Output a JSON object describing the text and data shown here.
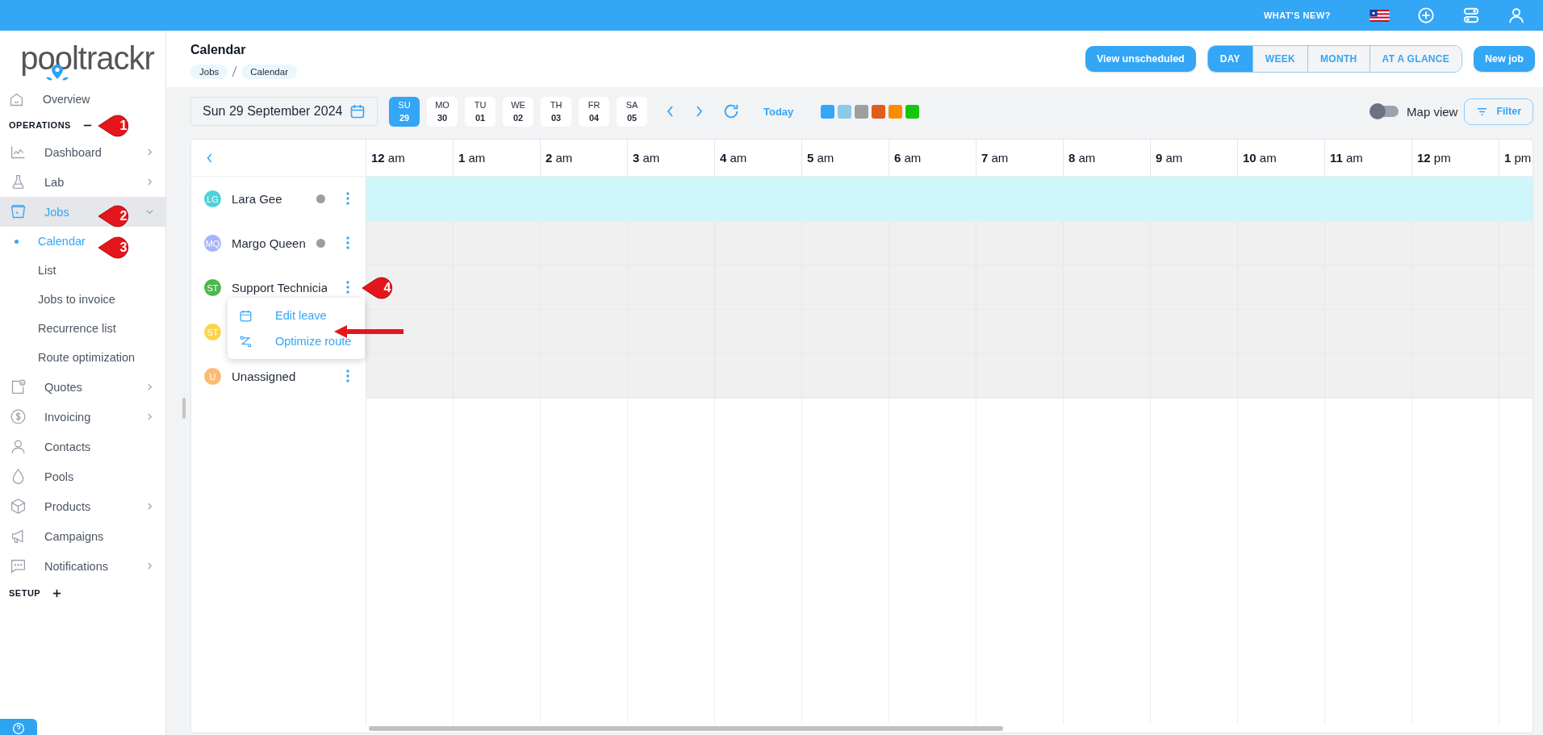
{
  "topbar": {
    "whats_new": "WHAT'S NEW?"
  },
  "logo": {
    "text": "pooltrackr"
  },
  "sidebar": {
    "top_item": {
      "label": "Overview",
      "selected": false
    },
    "sections": [
      {
        "title": "OPERATIONS",
        "expanded": true,
        "items": [
          {
            "label": "Dashboard",
            "selected": false,
            "has_children": true,
            "expanded": false
          },
          {
            "label": "Lab",
            "selected": false,
            "has_children": true,
            "expanded": false
          },
          {
            "label": "Jobs",
            "selected": true,
            "has_children": true,
            "expanded": true,
            "children": [
              {
                "label": "Calendar",
                "selected": true
              },
              {
                "label": "List",
                "selected": false
              },
              {
                "label": "Jobs to invoice",
                "selected": false
              },
              {
                "label": "Recurrence list",
                "selected": false
              },
              {
                "label": "Route optimization",
                "selected": false
              }
            ]
          },
          {
            "label": "Quotes",
            "selected": false,
            "has_children": true,
            "expanded": false
          },
          {
            "label": "Invoicing",
            "selected": false,
            "has_children": true,
            "expanded": false
          },
          {
            "label": "Contacts",
            "selected": false,
            "has_children": false
          },
          {
            "label": "Pools",
            "selected": false,
            "has_children": false
          },
          {
            "label": "Products",
            "selected": false,
            "has_children": true,
            "expanded": false
          },
          {
            "label": "Campaigns",
            "selected": false,
            "has_children": false
          },
          {
            "label": "Notifications",
            "selected": false,
            "has_children": true,
            "expanded": false
          }
        ]
      },
      {
        "title": "SETUP",
        "expanded": false
      }
    ]
  },
  "header": {
    "title": "Calendar",
    "breadcrumbs": [
      "Jobs",
      "Calendar"
    ],
    "view_unscheduled": "View unscheduled",
    "view_tabs": [
      {
        "label": "DAY",
        "selected": true
      },
      {
        "label": "WEEK",
        "selected": false
      },
      {
        "label": "MONTH",
        "selected": false
      },
      {
        "label": "AT A GLANCE",
        "selected": false
      }
    ],
    "new_job": "New job"
  },
  "toolbar": {
    "date": "Sun 29 September 2024",
    "days": [
      {
        "dow": "SU",
        "date": "29",
        "selected": true
      },
      {
        "dow": "MO",
        "date": "30",
        "selected": false
      },
      {
        "dow": "TU",
        "date": "01",
        "selected": false
      },
      {
        "dow": "WE",
        "date": "02",
        "selected": false
      },
      {
        "dow": "TH",
        "date": "03",
        "selected": false
      },
      {
        "dow": "FR",
        "date": "04",
        "selected": false
      },
      {
        "dow": "SA",
        "date": "05",
        "selected": false
      }
    ],
    "today": "Today",
    "color_filters": [
      {
        "color": "#33a6f5"
      },
      {
        "color": "#8ecae6"
      },
      {
        "color": "#9e9e9e"
      },
      {
        "color": "#e05d1b"
      },
      {
        "color": "#fb8c00"
      },
      {
        "color": "#16c60c"
      }
    ],
    "map_view": {
      "label": "Map view",
      "on": false
    },
    "filter": "Filter"
  },
  "grid": {
    "hours": [
      {
        "hour": "12",
        "ampm": "am"
      },
      {
        "hour": "1",
        "ampm": "am"
      },
      {
        "hour": "2",
        "ampm": "am"
      },
      {
        "hour": "3",
        "ampm": "am"
      },
      {
        "hour": "4",
        "ampm": "am"
      },
      {
        "hour": "5",
        "ampm": "am"
      },
      {
        "hour": "6",
        "ampm": "am"
      },
      {
        "hour": "7",
        "ampm": "am"
      },
      {
        "hour": "8",
        "ampm": "am"
      },
      {
        "hour": "9",
        "ampm": "am"
      },
      {
        "hour": "10",
        "ampm": "am"
      },
      {
        "hour": "11",
        "ampm": "am"
      },
      {
        "hour": "12",
        "ampm": "pm"
      },
      {
        "hour": "1",
        "ampm": "pm"
      }
    ],
    "resources": [
      {
        "initials": "LG",
        "name": "Lara Gee",
        "color": "#4fd1d9",
        "status_dot": true,
        "highlighted": true
      },
      {
        "initials": "MQ",
        "name": "Margo Queen",
        "color": "#a5b4fc",
        "status_dot": true,
        "highlighted": false
      },
      {
        "initials": "ST",
        "name": "Support Technicia",
        "color": "#4cb84c",
        "highlighted": false,
        "menu": [
          {
            "label": "Edit leave"
          },
          {
            "label": "Optimize route"
          }
        ]
      },
      {
        "initials": "ST",
        "color": "#fcd34d",
        "highlighted": false
      },
      {
        "initials": "U",
        "name": "Unassigned",
        "color": "#fdba74",
        "highlighted": false
      }
    ]
  },
  "callouts": [
    {
      "number": "1"
    },
    {
      "number": "2"
    },
    {
      "number": "3"
    },
    {
      "number": "4"
    }
  ]
}
